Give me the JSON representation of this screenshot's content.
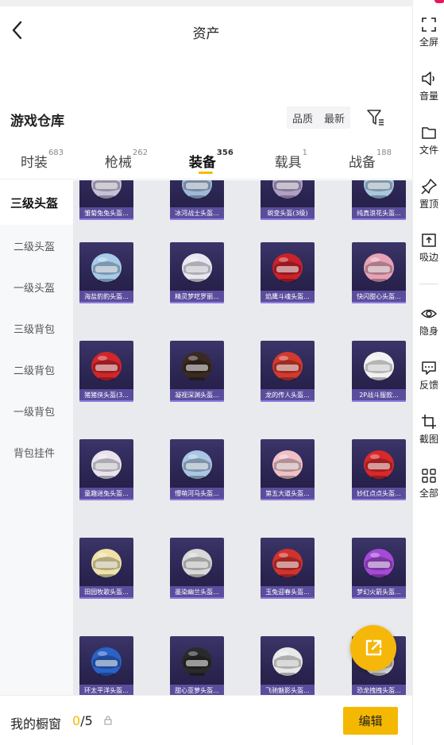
{
  "header": {
    "title": "资产"
  },
  "warehouse": {
    "title": "游戏仓库",
    "sort_quality": "品质",
    "sort_latest": "最新"
  },
  "tabs": [
    {
      "label": "时装",
      "count": "683"
    },
    {
      "label": "枪械",
      "count": "262"
    },
    {
      "label": "装备",
      "count": "356"
    },
    {
      "label": "载具",
      "count": "1"
    },
    {
      "label": "战备",
      "count": "188"
    }
  ],
  "sidebar": {
    "items": [
      {
        "label": "三级头盔"
      },
      {
        "label": "二级头盔"
      },
      {
        "label": "一级头盔"
      },
      {
        "label": "三级背包"
      },
      {
        "label": "二级背包"
      },
      {
        "label": "一级背包"
      },
      {
        "label": "背包挂件"
      }
    ]
  },
  "items": [
    {
      "name": "雏菊兔兔头盔...",
      "icon": "helmet-icon",
      "color": "#c8c0d8"
    },
    {
      "name": "冰河战士头盔...",
      "icon": "helmet-icon",
      "color": "#9fb8d8"
    },
    {
      "name": "蜕变头盔(3级)",
      "icon": "helmet-icon",
      "color": "#b0a0c8"
    },
    {
      "name": "纯真浪花头盔...",
      "icon": "helmet-icon",
      "color": "#a8c8e0"
    },
    {
      "name": "海盐豹豹头盔...",
      "icon": "helmet-icon",
      "color": "#a7cbe8"
    },
    {
      "name": "精灵梦呓罗丽...",
      "icon": "helmet-icon",
      "color": "#e9e6f2"
    },
    {
      "name": "焰鹰斗魂头盔...",
      "icon": "helmet-icon",
      "color": "#c8222a"
    },
    {
      "name": "快闪甜心头盔...",
      "icon": "helmet-icon",
      "color": "#e7a3b5"
    },
    {
      "name": "猪猪侠头盔(3...",
      "icon": "helmet-icon",
      "color": "#d0262a"
    },
    {
      "name": "凝视深渊头盔...",
      "icon": "helmet-icon",
      "color": "#3a2a22"
    },
    {
      "name": "龙的传人头盔...",
      "icon": "helmet-icon",
      "color": "#d23a2e"
    },
    {
      "name": "2P战斗服款...",
      "icon": "helmet-icon",
      "color": "#f2f2f2"
    },
    {
      "name": "童趣迷兔头盔...",
      "icon": "helmet-icon",
      "color": "#e9e3ee"
    },
    {
      "name": "懵萌河马头盔...",
      "icon": "helmet-icon",
      "color": "#a9c6e3"
    },
    {
      "name": "第五大道头盔...",
      "icon": "helmet-icon",
      "color": "#efc1c6"
    },
    {
      "name": "妙红点点头盔...",
      "icon": "helmet-icon",
      "color": "#d8282c"
    },
    {
      "name": "田园牧歌头盔...",
      "icon": "helmet-icon",
      "color": "#efe2a8"
    },
    {
      "name": "墨染幽兰头盔...",
      "icon": "helmet-icon",
      "color": "#d8d8d8"
    },
    {
      "name": "玉兔迎春头盔...",
      "icon": "helmet-icon",
      "color": "#d2322e"
    },
    {
      "name": "梦幻火箭头盔...",
      "icon": "helmet-icon",
      "color": "#a54ad8"
    },
    {
      "name": "环太平洋头盔...",
      "icon": "helmet-icon",
      "color": "#2a62c8"
    },
    {
      "name": "甜心亚萝头盔...",
      "icon": "helmet-icon",
      "color": "#2a2a2a"
    },
    {
      "name": "飞驰魅影头盔...",
      "icon": "helmet-icon",
      "color": "#e8e8e8"
    },
    {
      "name": "恐龙拽拽头盔...",
      "icon": "helmet-icon",
      "color": "#d8d8d8"
    }
  ],
  "bottom": {
    "label": "我的橱窗",
    "current": "0",
    "total": "/5",
    "edit_label": "编辑"
  },
  "right_panel": [
    {
      "label": "全屏",
      "icon": "fullscreen-icon"
    },
    {
      "label": "音量",
      "icon": "speaker-icon"
    },
    {
      "label": "文件",
      "icon": "folder-icon"
    },
    {
      "label": "置顶",
      "icon": "pin-icon"
    },
    {
      "label": "吸边",
      "icon": "dock-edge-icon"
    },
    {
      "label": "隐身",
      "icon": "eye-icon"
    },
    {
      "label": "反馈",
      "icon": "feedback-icon"
    },
    {
      "label": "截图",
      "icon": "crop-icon"
    },
    {
      "label": "全部",
      "icon": "grid-icon"
    }
  ],
  "colors": {
    "accent": "#f5b800",
    "item_bg": "#2a2450",
    "item_label_bg": "#5b4d9c"
  }
}
